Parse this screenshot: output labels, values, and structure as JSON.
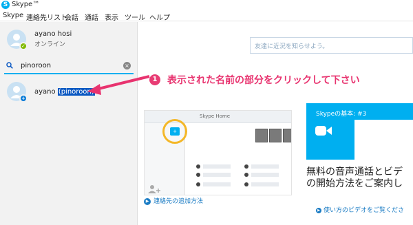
{
  "window": {
    "title": "Skype™",
    "logo_glyph": "S"
  },
  "menu": [
    "Skype",
    "連絡先リスト",
    "会話",
    "通話",
    "表示",
    "ツール",
    "ヘルプ"
  ],
  "profile": {
    "name": "ayano hosi",
    "status": "オンライン",
    "presence_badge": "✓"
  },
  "search": {
    "value": "pinoroon",
    "clear_glyph": "×"
  },
  "result": {
    "name_prefix": "ayano ",
    "name_highlight": "(pinoroon)",
    "add_badge": "+"
  },
  "mood": {
    "placeholder": "友達に近況を知らせよう。"
  },
  "callout": {
    "step_number": "1",
    "text": "表示された名前の部分をクリックして下さい",
    "color": "#e8336f"
  },
  "tutorial": {
    "header_text": "Skype Home",
    "caption": "連絡先の追加方法"
  },
  "tip_card": {
    "label": "Skypeの基本: #3",
    "description_line1": "無料の音声通話とビデ",
    "description_line2": "の開始方法をご案内し",
    "watch_link": "使い方のビデオをご覧くださ"
  },
  "colors": {
    "accent": "#00aff0",
    "link": "#1b7cc4",
    "highlight": "#0a58c2",
    "online": "#7fba00"
  }
}
